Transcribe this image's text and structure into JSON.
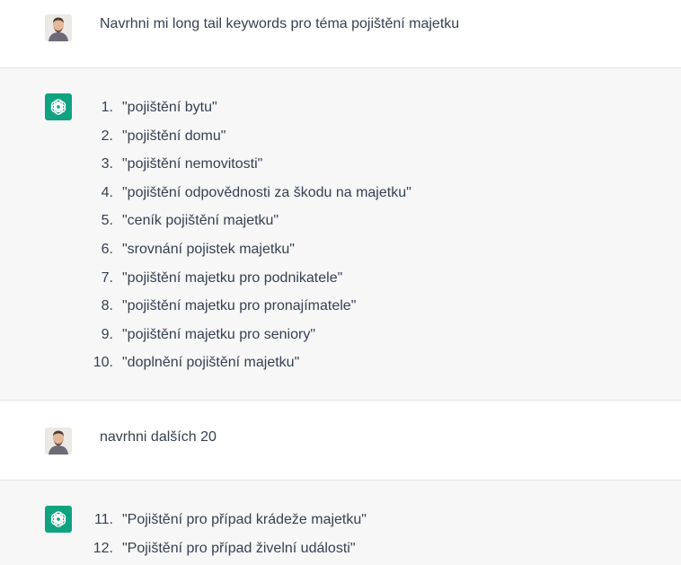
{
  "conversation": [
    {
      "role": "user",
      "text": "Navrhni mi long tail keywords pro téma pojištění majetku"
    },
    {
      "role": "assistant",
      "items": [
        {
          "num": "1.",
          "text": "\"pojištění bytu\""
        },
        {
          "num": "2.",
          "text": "\"pojištění domu\""
        },
        {
          "num": "3.",
          "text": "\"pojištění nemovitosti\""
        },
        {
          "num": "4.",
          "text": "\"pojištění odpovědnosti za škodu na majetku\""
        },
        {
          "num": "5.",
          "text": "\"ceník pojištění majetku\""
        },
        {
          "num": "6.",
          "text": "\"srovnání pojistek majetku\""
        },
        {
          "num": "7.",
          "text": "\"pojištění majetku pro podnikatele\""
        },
        {
          "num": "8.",
          "text": "\"pojištění majetku pro pronajímatele\""
        },
        {
          "num": "9.",
          "text": "\"pojištění majetku pro seniory\""
        },
        {
          "num": "10.",
          "text": "\"doplnění pojištění majetku\""
        }
      ]
    },
    {
      "role": "user",
      "text": "navrhni dalších 20"
    },
    {
      "role": "assistant",
      "items": [
        {
          "num": "11.",
          "text": "\"Pojištění pro případ krádeže majetku\""
        },
        {
          "num": "12.",
          "text": "\"Pojištění pro případ živelní události\""
        }
      ]
    }
  ],
  "icons": {
    "user_avatar": "user-avatar-photo",
    "assistant_avatar": "openai-logo-icon"
  },
  "colors": {
    "assistant_bg": "#f7f7f8",
    "user_bg": "#ffffff",
    "logo_bg": "#10a37f",
    "text": "#374151"
  }
}
